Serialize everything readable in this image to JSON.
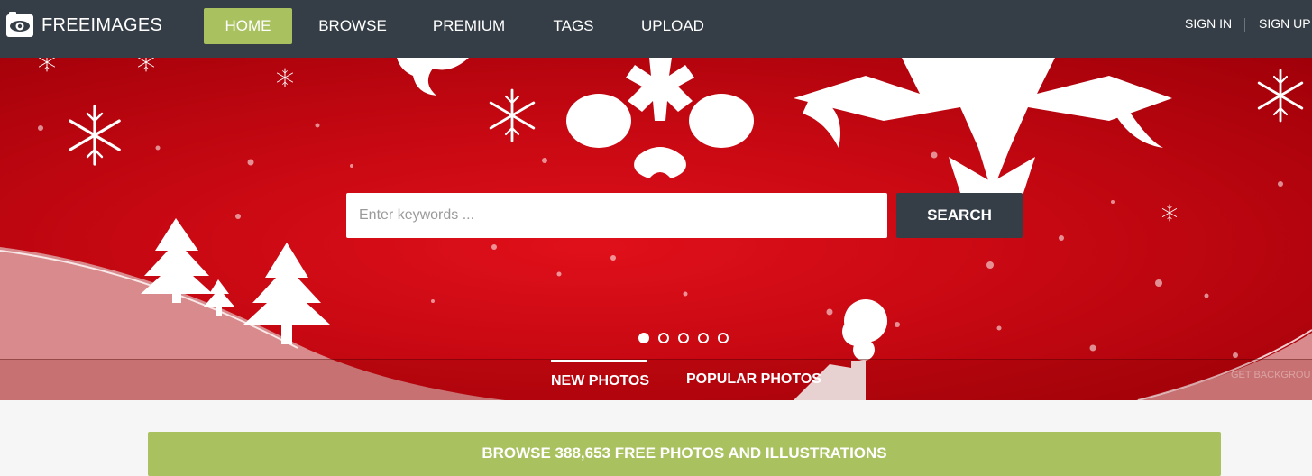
{
  "brand": {
    "name": "FREEIMAGES",
    "logo_icon": "camera-eye-icon"
  },
  "nav": {
    "items": [
      {
        "label": "HOME",
        "active": true
      },
      {
        "label": "BROWSE",
        "active": false
      },
      {
        "label": "PREMIUM",
        "active": false
      },
      {
        "label": "TAGS",
        "active": false
      },
      {
        "label": "UPLOAD",
        "active": false
      }
    ],
    "sign_in": "SIGN IN",
    "sign_up": "SIGN UP"
  },
  "search": {
    "placeholder": "Enter keywords ...",
    "value": "",
    "button_label": "SEARCH"
  },
  "carousel": {
    "slide_count": 5,
    "active_index": 0
  },
  "tabs": [
    {
      "label": "NEW PHOTOS",
      "active": true
    },
    {
      "label": "POPULAR PHOTOS",
      "active": false
    }
  ],
  "background_credit": "GET BACKGROU",
  "browse_banner": "BROWSE 388,653 FREE PHOTOS AND ILLUSTRATIONS",
  "colors": {
    "nav_bg": "#353e47",
    "accent_green": "#a9c15f",
    "hero_red": "#c60812",
    "search_button": "#353e47"
  }
}
